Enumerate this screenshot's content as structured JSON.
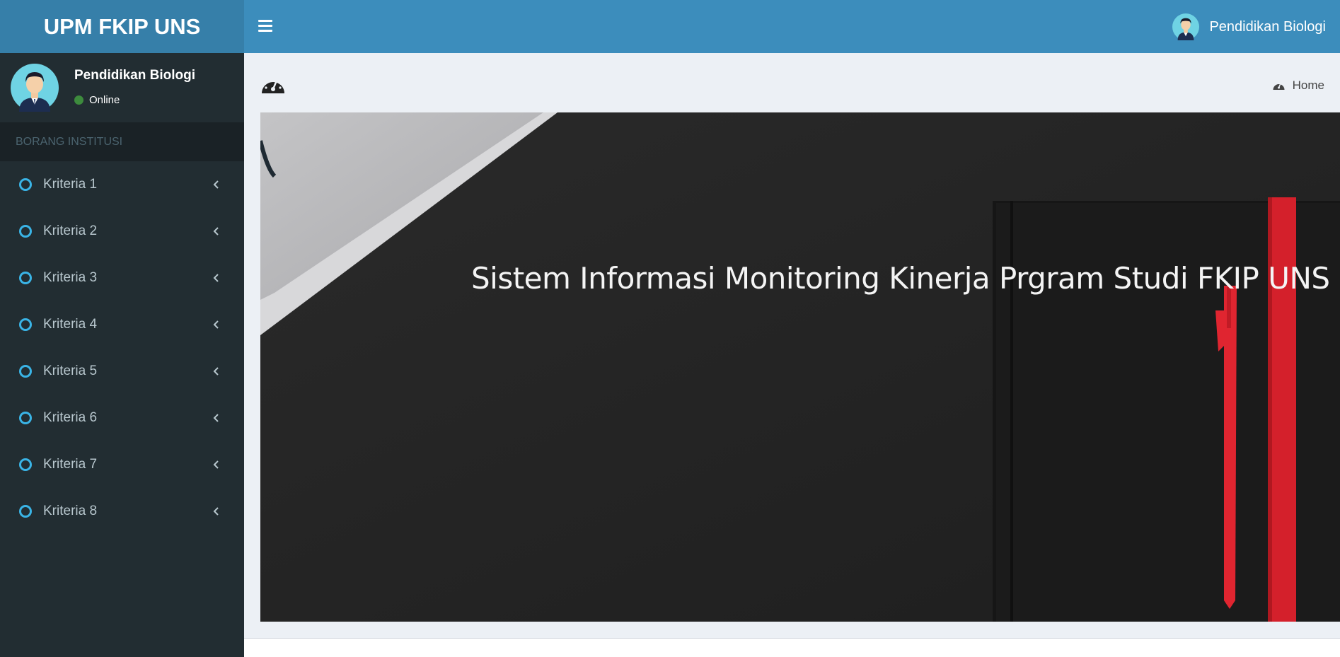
{
  "app": {
    "brand": "UPM FKIP UNS"
  },
  "navbar": {
    "user_name": "Pendidikan Biologi"
  },
  "sidebar": {
    "user": {
      "name": "Pendidikan Biologi",
      "status": "Online"
    },
    "section_header": "BORANG INSTITUSI",
    "items": [
      {
        "label": "Kriteria 1"
      },
      {
        "label": "Kriteria 2"
      },
      {
        "label": "Kriteria 3"
      },
      {
        "label": "Kriteria 4"
      },
      {
        "label": "Kriteria 5"
      },
      {
        "label": "Kriteria 6"
      },
      {
        "label": "Kriteria 7"
      },
      {
        "label": "Kriteria 8"
      }
    ]
  },
  "content": {
    "breadcrumb": "Home",
    "banner_title": "Sistem Informasi Monitoring Kinerja Prgram Studi FKIP UNS"
  },
  "colors": {
    "header_primary": "#3c8dbc",
    "header_logo": "#367fa9",
    "sidebar_bg": "#222d32",
    "accent_circle": "#3ab4e6",
    "online_dot": "#3d8b3d",
    "notebook_band": "#d4202b"
  },
  "icons": [
    "hamburger-icon",
    "user-avatar-icon",
    "circle-icon",
    "chevron-left-icon",
    "dashboard-gauge-icon"
  ]
}
